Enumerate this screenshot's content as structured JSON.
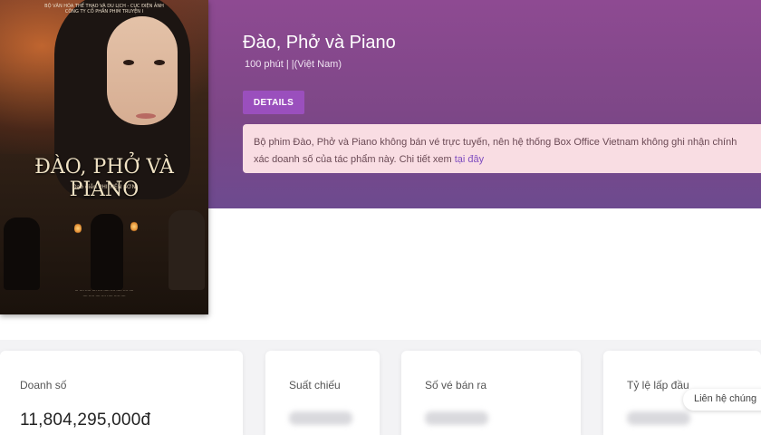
{
  "movie": {
    "title": "Đào, Phở và Piano",
    "meta": "100 phút  |  |(Việt Nam)",
    "details_label": "DETAILS"
  },
  "poster": {
    "top_text": "BỘ VĂN HÓA THỂ THAO VÀ DU LỊCH - CỤC ĐIỆN ẢNH\nCÔNG TY CỔ PHẦN PHIM TRUYỆN I",
    "title": "ĐÀO, PHỞ VÀ PIANO",
    "director": "Đạo diễn PHI TIẾN SƠN"
  },
  "notice": {
    "text": "Bộ phim Đào, Phở và Piano không bán vé trực tuyến, nên hệ thống Box Office Vietnam không ghi nhận chính xác doanh số của tác phẩm này. Chi tiết xem ",
    "link_label": "tại đây"
  },
  "stats": [
    {
      "label": "Doanh số",
      "value": "11,804,295,000đ"
    },
    {
      "label": "Suất chiếu",
      "value": ""
    },
    {
      "label": "Số vé bán ra",
      "value": ""
    },
    {
      "label": "Tỷ lệ lấp đầu",
      "value": ""
    }
  ],
  "contact_label": "Liên hệ chúng",
  "colors": {
    "banner": "#7d4787",
    "button": "#9a4fbd",
    "notice_bg": "#f9dde3",
    "link": "#7f4cc0"
  }
}
